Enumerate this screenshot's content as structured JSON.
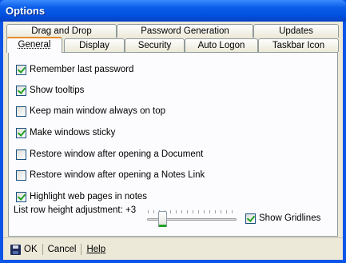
{
  "window": {
    "title": "Options"
  },
  "tabs": {
    "back_row": [
      "Drag and Drop",
      "Password Generation",
      "Updates"
    ],
    "front_row": [
      "General",
      "Display",
      "Security",
      "Auto Logon",
      "Taskbar Icon"
    ],
    "active": "General"
  },
  "options": [
    {
      "label": "Remember last password",
      "checked": true
    },
    {
      "label": "Show tooltips",
      "checked": true
    },
    {
      "label": "Keep main window always on top",
      "checked": false
    },
    {
      "label": "Make windows sticky",
      "checked": true
    },
    {
      "label": "Restore window after opening a Document",
      "checked": false
    },
    {
      "label": "Restore window after opening a Notes Link",
      "checked": false
    },
    {
      "label": "Highlight web pages in notes",
      "checked": true
    }
  ],
  "row_height": {
    "label": "List row height adjustment: +3",
    "value": 3
  },
  "show_gridlines": {
    "label": "Show Gridlines",
    "checked": true
  },
  "buttons": {
    "ok": "OK",
    "cancel": "Cancel",
    "help": "Help"
  },
  "icons": {
    "ok": "floppy-disk-icon"
  },
  "colors": {
    "titlebar": "#0a54e8",
    "panel": "#fcfcfe",
    "dialog": "#ece9d8",
    "check": "#21a121",
    "active_tab": "#e68b2c"
  }
}
